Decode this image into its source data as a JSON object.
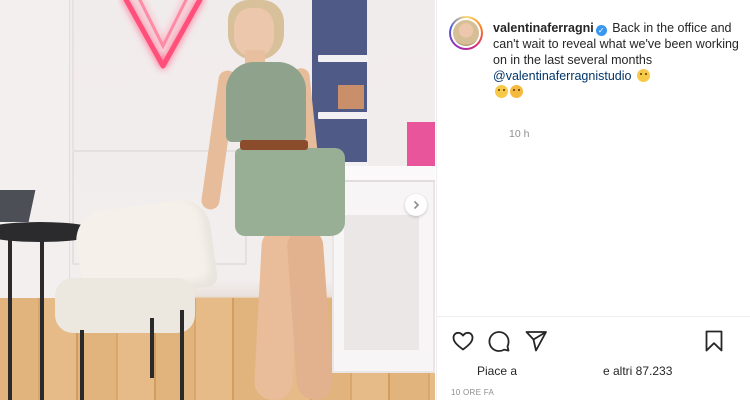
{
  "post": {
    "username": "valentinaferragni",
    "verified": true,
    "caption_text": "Back in the office and can't wait to reveal what we've been working on in the last several months",
    "mention": "@valentinaferragnistudio",
    "time_ago": "10 h",
    "likes_prefix": "Piace a",
    "likes_suffix": "e altri 87.233",
    "date_label": "10 ORE FA"
  },
  "icons": {
    "like": "heart-icon",
    "comment": "comment-icon",
    "share": "share-icon",
    "save": "bookmark-icon",
    "next": "chevron-right-icon",
    "verified": "verified-badge-icon"
  },
  "colors": {
    "link": "#00376b",
    "verified": "#3897f0",
    "muted": "#8e8e8e",
    "text": "#262626",
    "neon": "#ff4f7a"
  }
}
